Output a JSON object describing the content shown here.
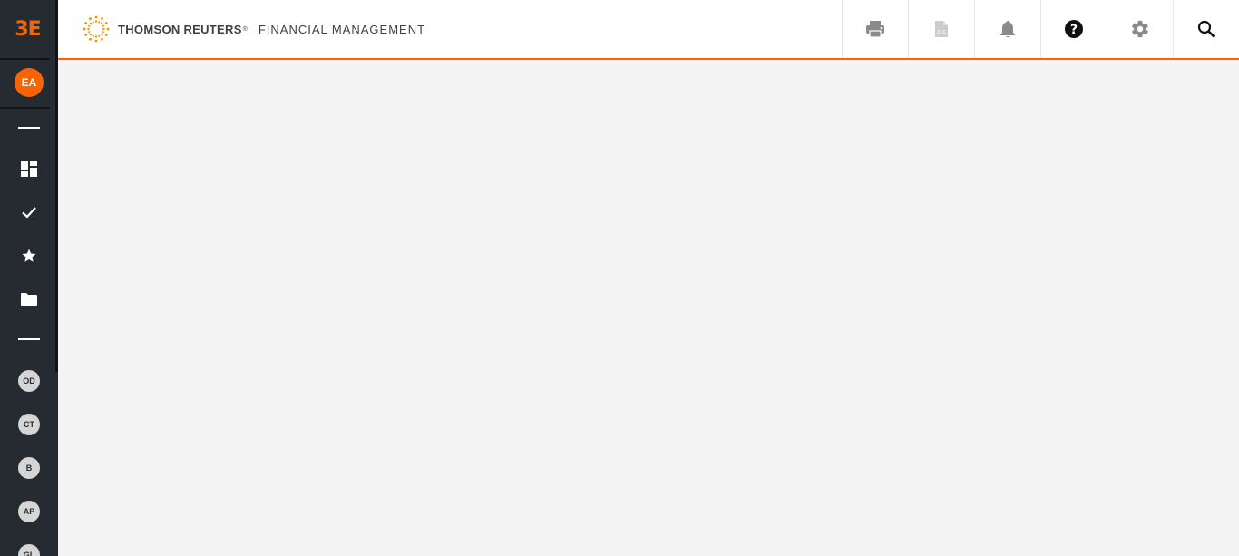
{
  "sidebar": {
    "brand": "3E",
    "user_initials": "EA",
    "badges": [
      {
        "label": "OD"
      },
      {
        "label": "CT"
      },
      {
        "label": "B"
      },
      {
        "label": "AP"
      },
      {
        "label": "GL"
      }
    ]
  },
  "header": {
    "company": "THOMSON REUTERS",
    "registered": "®",
    "product": "FINANCIAL MANAGEMENT"
  },
  "colors": {
    "accent": "#fa6400",
    "sidebar_bg": "#262b31",
    "content_bg": "#f4f4f4"
  },
  "toolbar": {
    "icons": [
      "print-icon",
      "excel-export-icon",
      "notification-bell-icon",
      "help-icon",
      "settings-gear-icon",
      "search-icon"
    ]
  }
}
